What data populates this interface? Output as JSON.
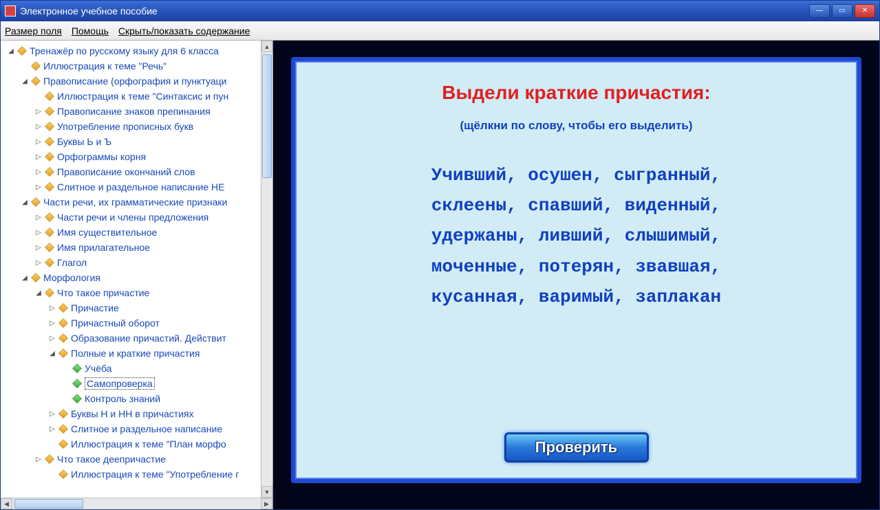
{
  "window": {
    "title": "Электронное учебное пособие"
  },
  "menu": {
    "field_size": "Размер поля",
    "help": "Помощь",
    "toggle_toc": "Скрыть/показать содержание"
  },
  "tree": [
    {
      "indent": 0,
      "tw": "▾",
      "label": "Тренажёр по русскому языку для 6 класса"
    },
    {
      "indent": 1,
      "tw": "",
      "label": "Иллюстрация к теме \"Речь\""
    },
    {
      "indent": 1,
      "tw": "▾",
      "label": "Правописание (орфография и пунктуаци"
    },
    {
      "indent": 2,
      "tw": "",
      "label": "Иллюстрация к теме \"Синтаксис и пун"
    },
    {
      "indent": 2,
      "tw": "▸",
      "label": "Правописание знаков препинания"
    },
    {
      "indent": 2,
      "tw": "▸",
      "label": "Употребление прописных букв"
    },
    {
      "indent": 2,
      "tw": "▸",
      "label": "Буквы Ь и Ъ"
    },
    {
      "indent": 2,
      "tw": "▸",
      "label": "Орфограммы корня"
    },
    {
      "indent": 2,
      "tw": "▸",
      "label": "Правописание окончаний слов"
    },
    {
      "indent": 2,
      "tw": "▸",
      "label": "Слитное и раздельное написание НЕ"
    },
    {
      "indent": 1,
      "tw": "▾",
      "label": "Части речи, их грамматические признаки"
    },
    {
      "indent": 2,
      "tw": "▸",
      "label": "Части речи и члены предложения"
    },
    {
      "indent": 2,
      "tw": "▸",
      "label": "Имя существительное"
    },
    {
      "indent": 2,
      "tw": "▸",
      "label": "Имя прилагательное"
    },
    {
      "indent": 2,
      "tw": "▸",
      "label": "Глагол"
    },
    {
      "indent": 1,
      "tw": "▾",
      "label": "Морфология"
    },
    {
      "indent": 2,
      "tw": "▾",
      "label": "Что такое причастие"
    },
    {
      "indent": 3,
      "tw": "▸",
      "label": "Причастие"
    },
    {
      "indent": 3,
      "tw": "▸",
      "label": "Причастный оборот"
    },
    {
      "indent": 3,
      "tw": "▸",
      "label": "Образование причастий. Действит"
    },
    {
      "indent": 3,
      "tw": "▾",
      "label": "Полные и краткие причастия"
    },
    {
      "indent": 4,
      "tw": "",
      "label": "Учёба",
      "green": true
    },
    {
      "indent": 4,
      "tw": "",
      "label": "Самопроверка",
      "green": true,
      "selected": true
    },
    {
      "indent": 4,
      "tw": "",
      "label": "Контроль знаний",
      "green": true
    },
    {
      "indent": 3,
      "tw": "▸",
      "label": "Буквы Н и НН в причастиях"
    },
    {
      "indent": 3,
      "tw": "▸",
      "label": "Слитное и раздельное написание"
    },
    {
      "indent": 3,
      "tw": "",
      "label": "Иллюстрация к теме \"План морфо"
    },
    {
      "indent": 2,
      "tw": "▸",
      "label": "Что такое деепричастие"
    },
    {
      "indent": 3,
      "tw": "",
      "label": "Иллюстрация к теме \"Употребление г"
    }
  ],
  "exercise": {
    "heading": "Выдели краткие причастия:",
    "hint": "(щёлкни по слову, чтобы его выделить)",
    "words": [
      "Учивший",
      "осушен",
      "сыгранный",
      "склеены",
      "спавший",
      "виденный",
      "удержаны",
      "ливший",
      "слышимый",
      "моченные",
      "потерян",
      "звавшая",
      "кусанная",
      "варимый",
      "заплакан"
    ],
    "check_button": "Проверить"
  }
}
